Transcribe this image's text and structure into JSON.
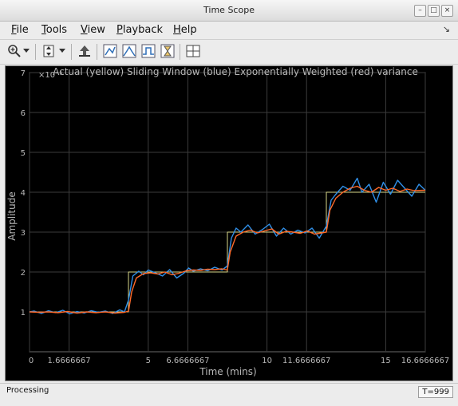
{
  "window": {
    "title": "Time Scope"
  },
  "menu": {
    "items": [
      {
        "label": "File",
        "mnemonic": "F",
        "rest": "ile"
      },
      {
        "label": "Tools",
        "mnemonic": "T",
        "rest": "ools"
      },
      {
        "label": "View",
        "mnemonic": "V",
        "rest": "iew"
      },
      {
        "label": "Playback",
        "mnemonic": "P",
        "rest": "layback"
      },
      {
        "label": "Help",
        "mnemonic": "H",
        "rest": "elp"
      }
    ]
  },
  "toolbar": {
    "icons": [
      "zoom-in-icon",
      "dropdown-arrow-icon",
      "scale-axes-icon",
      "dropdown-arrow-icon",
      "restore-view-icon",
      "triggers-icon",
      "peak-finder-icon",
      "bilevel-icon",
      "cursor-measurements-icon",
      "layout-icon"
    ]
  },
  "status": {
    "left": "Processing",
    "right": "T=999"
  },
  "colors": {
    "background": "#000000",
    "grid": "#3c3c3c",
    "axis_text": "#b8b8b8",
    "actual": "#d8d88a",
    "sliding": "#2f8fe8",
    "ewma": "#ff6a2a"
  },
  "chart_data": {
    "type": "line",
    "title": "Actual (yellow) Sliding Window (blue) Exponentially Weighted (red) variance",
    "xlabel": "Time (mins)",
    "ylabel": "Amplitude",
    "xlim": [
      0,
      16.6666667
    ],
    "ylim": [
      0,
      7
    ],
    "x_tick_values": [
      0,
      1.6666667,
      5,
      6.6666667,
      10,
      11.6666667,
      15,
      16.6666667
    ],
    "x_tick_labels": [
      "0",
      "1.6666667",
      "5",
      "6.6666667",
      "10",
      "11.6666667",
      "15",
      "16.6666667"
    ],
    "y_tick_values": [
      1,
      2,
      3,
      4,
      5,
      6,
      7
    ],
    "y_tick_labels": [
      "1",
      "2",
      "3",
      "4",
      "5",
      "6",
      "7"
    ],
    "y_multiplier": "×10⁻³",
    "grid": true,
    "series": [
      {
        "name": "Actual",
        "color": "#d8d88a",
        "x": [
          0,
          4.1667,
          4.1667,
          8.3333,
          8.3333,
          12.5,
          12.5,
          16.6667
        ],
        "y": [
          1,
          1,
          2,
          2,
          3,
          3,
          4,
          4
        ]
      },
      {
        "name": "Sliding Window",
        "color": "#2f8fe8",
        "x": [
          0,
          0.2,
          0.5,
          0.8,
          1.1,
          1.4,
          1.7,
          2.0,
          2.3,
          2.6,
          2.9,
          3.2,
          3.5,
          3.8,
          4.0,
          4.17,
          4.35,
          4.6,
          4.8,
          5.0,
          5.3,
          5.6,
          5.9,
          6.2,
          6.5,
          6.7,
          6.9,
          7.2,
          7.5,
          7.8,
          8.1,
          8.33,
          8.5,
          8.7,
          8.9,
          9.2,
          9.5,
          9.8,
          10.1,
          10.4,
          10.7,
          11.0,
          11.3,
          11.6,
          11.9,
          12.2,
          12.5,
          12.7,
          12.9,
          13.2,
          13.5,
          13.8,
          14.0,
          14.3,
          14.6,
          14.9,
          15.2,
          15.5,
          15.8,
          16.1,
          16.4,
          16.6667
        ],
        "y": [
          1.0,
          1.02,
          0.96,
          1.03,
          0.98,
          1.04,
          0.95,
          1.01,
          0.97,
          1.03,
          0.99,
          1.02,
          0.96,
          1.05,
          1.0,
          1.3,
          1.9,
          2.02,
          1.93,
          2.05,
          1.98,
          1.9,
          2.06,
          1.85,
          1.97,
          2.1,
          2.02,
          2.08,
          2.03,
          2.12,
          2.05,
          2.15,
          2.85,
          3.1,
          3.0,
          3.18,
          2.95,
          3.06,
          3.2,
          2.9,
          3.1,
          2.95,
          3.05,
          2.98,
          3.1,
          2.85,
          3.15,
          3.8,
          3.95,
          4.15,
          4.05,
          4.35,
          4.0,
          4.2,
          3.75,
          4.25,
          3.95,
          4.3,
          4.1,
          3.9,
          4.2,
          4.05
        ]
      },
      {
        "name": "Exponentially Weighted",
        "color": "#ff6a2a",
        "x": [
          0,
          0.4,
          0.8,
          1.2,
          1.6,
          2.0,
          2.4,
          2.8,
          3.2,
          3.6,
          4.0,
          4.17,
          4.3,
          4.5,
          4.8,
          5.1,
          5.4,
          5.7,
          6.0,
          6.3,
          6.6,
          6.9,
          7.2,
          7.5,
          7.8,
          8.1,
          8.33,
          8.45,
          8.7,
          9.0,
          9.3,
          9.6,
          9.9,
          10.2,
          10.5,
          10.8,
          11.1,
          11.4,
          11.7,
          12.0,
          12.3,
          12.5,
          12.65,
          12.9,
          13.2,
          13.5,
          13.8,
          14.1,
          14.4,
          14.7,
          15.0,
          15.3,
          15.6,
          15.9,
          16.2,
          16.6667
        ],
        "y": [
          1.0,
          0.99,
          1.0,
          0.98,
          1.01,
          0.97,
          1.0,
          0.98,
          1.0,
          0.97,
          0.99,
          1.02,
          1.5,
          1.85,
          1.96,
          1.98,
          1.95,
          2.0,
          1.93,
          1.97,
          2.03,
          2.05,
          2.04,
          2.07,
          2.06,
          2.08,
          2.05,
          2.5,
          2.9,
          3.0,
          3.05,
          2.98,
          3.03,
          3.08,
          2.95,
          3.02,
          3.0,
          2.97,
          3.03,
          2.95,
          2.98,
          3.0,
          3.55,
          3.85,
          4.0,
          4.1,
          4.15,
          4.05,
          4.0,
          4.12,
          4.05,
          4.1,
          4.02,
          4.08,
          4.04,
          4.05
        ]
      }
    ]
  }
}
